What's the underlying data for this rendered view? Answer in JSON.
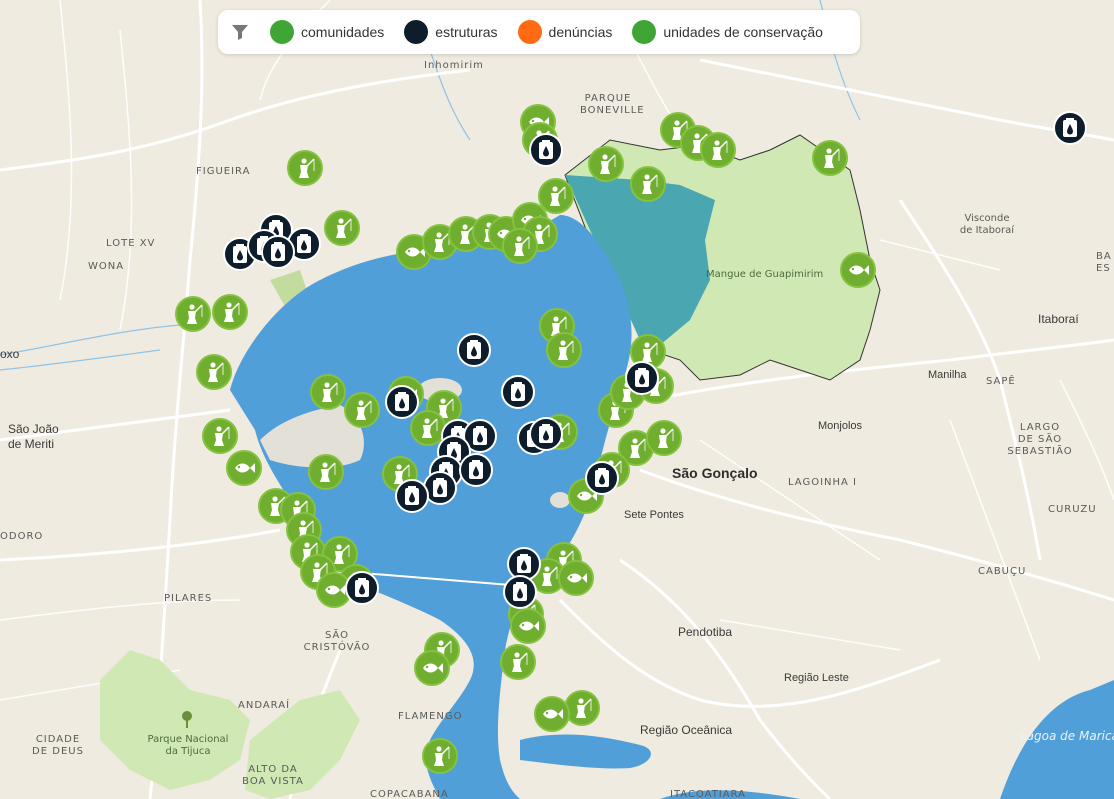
{
  "legend": {
    "filter_icon": "filter-icon",
    "items": [
      {
        "label": "comunidades",
        "color": "#3fa535"
      },
      {
        "label": "estruturas",
        "color": "#0e1d2b"
      },
      {
        "label": "denúncias",
        "color": "#ff6a13"
      },
      {
        "label": "unidades de conservação",
        "color": "#3fa535"
      }
    ]
  },
  "place_labels": {
    "inhomirim": "Inhomirim",
    "parque_boneville_1": "PARQUE",
    "parque_boneville_2": "BONEVILLE",
    "figueira": "FIGUEIRA",
    "lote_xv": "LOTE XV",
    "wona": "WONA",
    "visconde_1": "Visconde",
    "visconde_2": "de Itaboraí",
    "mangue": "Mangue de Guapimirim",
    "itaborai": "Itaboraí",
    "ba": "BA",
    "es": "ES",
    "oxo": "oxo",
    "sao_joao_1": "São João",
    "sao_joao_2": "de Meriti",
    "manilha": "Manilha",
    "sape": "SAPÊ",
    "largo_1": "LARGO",
    "largo_2": "DE SÃO",
    "largo_3": "SEBASTIÃO",
    "monjolos": "Monjolos",
    "sao_goncalo": "São Gonçalo",
    "lagoinha": "LAGOINHA I",
    "curuzu": "CURUZU",
    "sete_pontes": "Sete Pontes",
    "odoro": "ODORO",
    "cabucu": "CABUÇU",
    "pilares": "PILARES",
    "pendotiba": "Pendotiba",
    "sao_cristovao_1": "SÃO",
    "sao_cristovao_2": "CRISTÓVÃO",
    "regiao_leste": "Região Leste",
    "andarai": "ANDARAÍ",
    "flamengo": "FLAMENGO",
    "regiao_oceanica": "Região Oceânica",
    "lagoa_marica": "Lagoa de Marica",
    "cidade_de_deus_1": "CIDADE",
    "cidade_de_deus_2": "DE DEUS",
    "parque_tijuca_1": "Parque Nacional",
    "parque_tijuca_2": "da Tijuca",
    "alto_boa_vista_1": "ALTO DA",
    "alto_boa_vista_2": "BOA VISTA",
    "copacabana": "COPACABANA",
    "itacoatiara": "ITACOATIARA"
  },
  "markers": [
    {
      "kind": "comunidade",
      "icon": "fish-icon"
    },
    {
      "kind": "comunidade",
      "icon": "fisherman-icon"
    },
    {
      "kind": "estrutura",
      "icon": "oil-drop-icon"
    }
  ]
}
